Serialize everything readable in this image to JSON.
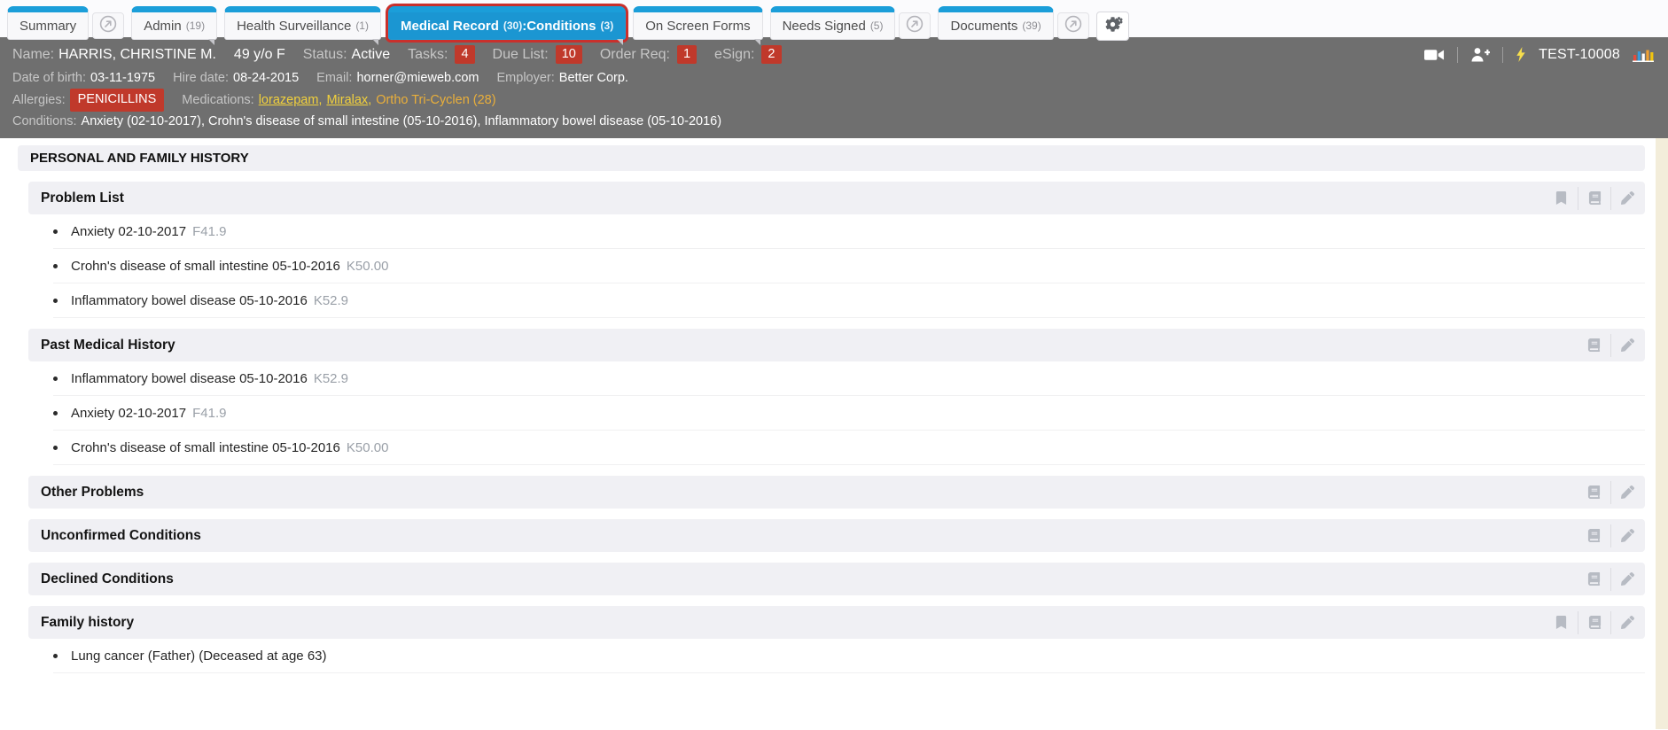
{
  "tabs": [
    {
      "label": "Summary"
    },
    {
      "label": "Admin",
      "count": "(19)"
    },
    {
      "label": "Health Surveillance",
      "count": "(1)"
    },
    {
      "label": "Medical Record",
      "count": "(30)",
      "label2": ":Conditions",
      "count2": "(3)"
    },
    {
      "label": "On Screen Forms"
    },
    {
      "label": "Needs Signed",
      "count": "(5)"
    },
    {
      "label": "Documents",
      "count": "(39)"
    }
  ],
  "patient": {
    "name_label": "Name:",
    "name": "HARRIS, CHRISTINE M.",
    "age_sex": "49 y/o F",
    "status_label": "Status:",
    "status": "Active",
    "tasks_label": "Tasks:",
    "tasks": "4",
    "due_list_label": "Due List:",
    "due_list": "10",
    "order_req_label": "Order Req:",
    "order_req": "1",
    "esign_label": "eSign:",
    "esign": "2",
    "station_id": "TEST-10008",
    "dob_label": "Date of birth:",
    "dob": "03-11-1975",
    "hire_label": "Hire date:",
    "hire": "08-24-2015",
    "email_label": "Email:",
    "email": "horner@mieweb.com",
    "employer_label": "Employer:",
    "employer": "Better Corp.",
    "allergies_label": "Allergies:",
    "allergy": "PENICILLINS",
    "medications_label": "Medications:",
    "medications": [
      "lorazepam",
      "Miralax",
      "Ortho Tri-Cyclen (28)"
    ],
    "med_separator": ",",
    "conditions_label": "Conditions:",
    "conditions": "Anxiety (02-10-2017), Crohn's disease of small intestine (05-10-2016), Inflammatory bowel disease (05-10-2016)"
  },
  "sections": {
    "title": "PERSONAL AND FAMILY HISTORY",
    "problem_list": {
      "title": "Problem List",
      "items": [
        {
          "text": "Anxiety 02-10-2017",
          "code": "F41.9"
        },
        {
          "text": "Crohn's disease of small intestine 05-10-2016",
          "code": "K50.00"
        },
        {
          "text": "Inflammatory bowel disease 05-10-2016",
          "code": "K52.9"
        }
      ]
    },
    "past_medical": {
      "title": "Past Medical History",
      "items": [
        {
          "text": "Inflammatory bowel disease 05-10-2016",
          "code": "K52.9"
        },
        {
          "text": "Anxiety 02-10-2017",
          "code": "F41.9"
        },
        {
          "text": "Crohn's disease of small intestine 05-10-2016",
          "code": "K50.00"
        }
      ]
    },
    "other_problems": {
      "title": "Other Problems"
    },
    "unconfirmed": {
      "title": "Unconfirmed Conditions"
    },
    "declined": {
      "title": "Declined Conditions"
    },
    "family_history": {
      "title": "Family history",
      "items": [
        {
          "text": "Lung cancer (Father) (Deceased at age 63)",
          "code": ""
        }
      ]
    }
  },
  "icons": {
    "external_link": "circle-arrow-up-right",
    "dropdown_fold": "folded-corner",
    "gear": "cogs",
    "video_camera": "camera",
    "add_person": "person-plus",
    "lightning": "bolt",
    "chart": "colored-bar-chart",
    "bookmark": "bookmark-filled",
    "book": "book",
    "pencil": "pencil"
  },
  "colors": {
    "tab_blue": "#1b9ed9",
    "active_tab_bg": "#1b96d2",
    "active_tab_border": "#c9302c",
    "badge_red": "#c0392b",
    "dark_bar": "#6f6f6f",
    "section_bg": "#f0f0f4",
    "beige_strip": "#f3edda",
    "icon_gray": "#b7bbc3",
    "med_yellow": "#f2d13c",
    "med_amber": "#eaaf3a"
  }
}
